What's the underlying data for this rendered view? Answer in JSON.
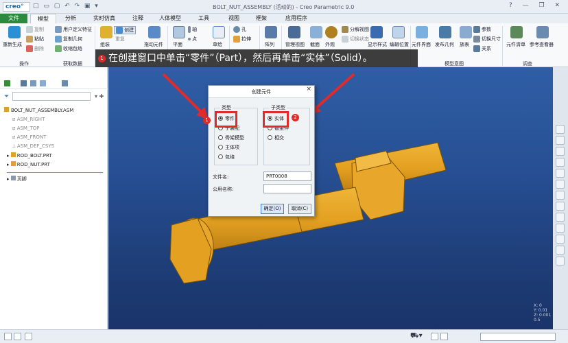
{
  "app": {
    "logo": "creo°",
    "window_title": "BOLT_NUT_ASSEMBLY (活动的) - Creo Parametric 9.0"
  },
  "tabs": [
    "文件",
    "模型",
    "分析",
    "实时仿真",
    "注释",
    "人体模型",
    "工具",
    "视图",
    "框架",
    "应用程序"
  ],
  "ribbon": {
    "regen": "重新生成",
    "copy": "复制",
    "paste": "粘贴",
    "delete": "删除",
    "user_feature": "用户定义特征",
    "copy_geom": "复制几何",
    "shrinkwrap": "收缩包络",
    "assemble": "组装",
    "create": "创建",
    "repeat": "重复",
    "drag": "拖动元件",
    "plane": "平面",
    "axis": "轴",
    "point": "点",
    "sketch": "草绘",
    "hole": "孔",
    "extrude": "拉伸",
    "pattern": "阵列",
    "manage_views": "管理视图",
    "section": "截面",
    "appearance": "外观",
    "explode": "分解视图",
    "toggle_state": "切换状态",
    "display_style": "显示样式",
    "edit_position": "编辑位置",
    "component_interface": "元件界面",
    "publish_geom": "发布几何",
    "family_table": "族表",
    "parameters": "参数",
    "switch_dims": "切换尺寸",
    "relations": "关系",
    "bom": "元件清单",
    "ref_viewer": "参考查看器",
    "group_operations": "操作",
    "group_get_data": "获取数据",
    "group_model_intent": "模型意图",
    "group_investigate": "调查"
  },
  "callout": {
    "badge": "1",
    "text": "在创建窗口中单击“零件”（Part），然后再单击“实体”（Solid）。"
  },
  "tree": {
    "root": "BOLT_NUT_ASSEMBLY.ASM",
    "items": [
      "ASM_RIGHT",
      "ASM_TOP",
      "ASM_FRONT",
      "ASM_DEF_CSYS",
      "ROD_BOLT.PRT",
      "ROD_NUT.PRT"
    ],
    "footer": "页脚"
  },
  "dialog": {
    "title": "创建元件",
    "type_label": "类型",
    "type_options": [
      "零件",
      "子装配",
      "骨架模型",
      "主体项",
      "包络"
    ],
    "type_selected": "零件",
    "subtype_label": "子类型",
    "subtype_options": [
      "实体",
      "钣金件",
      "相交"
    ],
    "subtype_selected": "实体",
    "filename_label": "文件名:",
    "filename_value": "PRT0008",
    "common_name_label": "公用名称:",
    "common_name_value": "",
    "ok": "确定(O)",
    "cancel": "取消(C)"
  },
  "annotations": {
    "badge1": "1",
    "badge2": "2"
  },
  "coords": [
    "X: 0",
    "Y: 0.01",
    "Z: 0.001",
    "0.5"
  ],
  "colors": {
    "file_tab": "#2a8a3e",
    "viewport": "#274f93",
    "bolt": "#e3a021",
    "highlight": "#e12a2a"
  }
}
